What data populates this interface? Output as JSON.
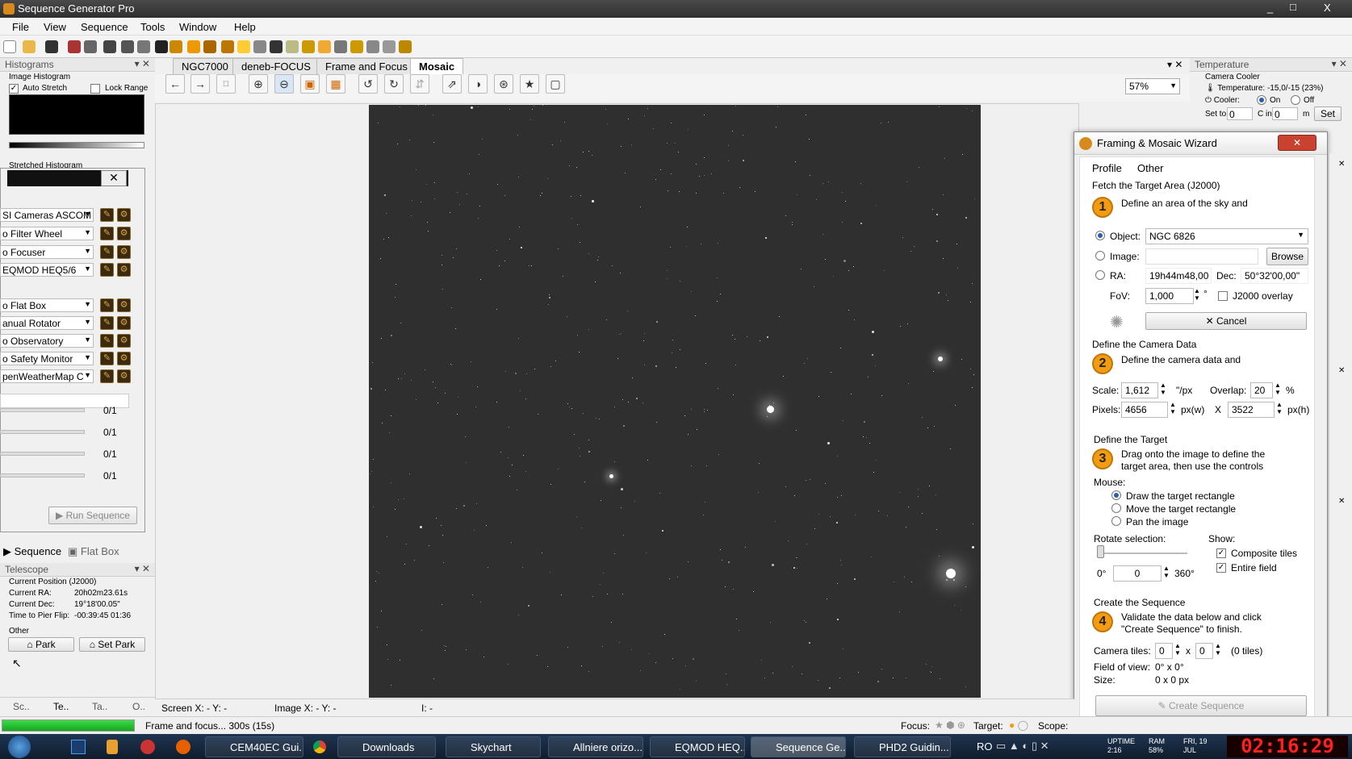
{
  "app": {
    "title": "Sequence Generator Pro",
    "window_controls": [
      "_",
      "□",
      "X"
    ]
  },
  "menu": [
    "File",
    "View",
    "Sequence",
    "Tools",
    "Window",
    "Help"
  ],
  "histograms": {
    "header": "Histograms",
    "image_histogram": "Image Histogram",
    "auto_stretch": "Auto Stretch",
    "lock_range": "Lock Range",
    "stretched": "Stretched Histogram"
  },
  "equipment": {
    "devices": [
      "SI Cameras ASCOM",
      "o Filter Wheel",
      "o Focuser",
      "EQMOD HEQ5/6",
      "o Flat Box",
      "anual Rotator",
      "o Observatory",
      "o Safety Monitor",
      "penWeatherMap C"
    ],
    "progress": [
      "0/1",
      "0/1",
      "0/1",
      "0/1"
    ],
    "run_sequence": "Run Sequence"
  },
  "left_tabs": [
    "Sequence",
    "Flat Box"
  ],
  "telescope": {
    "header": "Telescope",
    "current_position": "Current Position (J2000)",
    "rows": [
      {
        "label": "Current RA:",
        "value": "20h02m23.61s"
      },
      {
        "label": "Current Dec:",
        "value": "19°18'00.05\""
      },
      {
        "label": "Time to Pier Flip:",
        "value": "-00:39:45   01:36"
      }
    ],
    "other": "Other",
    "park": "Park",
    "set_park": "Set Park"
  },
  "bottom_tabs": [
    "Sc..",
    "Te..",
    "Ta..",
    "O.."
  ],
  "doc_tabs": [
    "NGC7000",
    "deneb-FOCUS",
    "Frame and Focus",
    "Mosaic"
  ],
  "zoom": "57%",
  "temperature": {
    "header": "Temperature",
    "camera_cooler": "Camera Cooler",
    "temp_line": "Temperature: -15,0/-15 (23%)",
    "cooler": "Cooler:",
    "on": "On",
    "off": "Off",
    "set_to": "Set to",
    "set_val": "0",
    "c_in": "C in",
    "c_val": "0",
    "m": "m",
    "set_btn": "Set"
  },
  "wizard": {
    "title": "Framing & Mosaic Wizard",
    "tabs": [
      "Profile",
      "Other"
    ],
    "s1": {
      "header": "Fetch the Target Area (J2000)",
      "num": "1",
      "desc": "Define an area of the sky and",
      "object_lbl": "Object:",
      "object_val": "NGC 6826",
      "image_lbl": "Image:",
      "browse": "Browse",
      "ra_lbl": "RA:",
      "ra_val": "19h44m48,00",
      "dec_lbl": "Dec:",
      "dec_val": "50°32'00,00\"",
      "fov_lbl": "FoV:",
      "fov_val": "1,000",
      "fov_unit": "°",
      "j2000": "J2000 overlay",
      "cancel": "Cancel"
    },
    "s2": {
      "header": "Define the Camera Data",
      "num": "2",
      "desc": "Define the camera data and",
      "scale_lbl": "Scale:",
      "scale_val": "1,612",
      "scale_unit": "\"/px",
      "overlap_lbl": "Overlap:",
      "overlap_val": "20",
      "pct": "%",
      "pixels_lbl": "Pixels:",
      "pw": "4656",
      "pw_unit": "px(w)",
      "x": "X",
      "ph": "3522",
      "ph_unit": "px(h)"
    },
    "s3": {
      "header": "Define the Target",
      "num": "3",
      "desc1": "Drag onto the image to define the",
      "desc2": "target area, then use the controls",
      "mouse": "Mouse:",
      "opts": [
        "Draw the target rectangle",
        "Move the target rectangle",
        "Pan the image"
      ],
      "rotate": "Rotate selection:",
      "show": "Show:",
      "composite": "Composite tiles",
      "entire": "Entire field",
      "deg0": "0°",
      "rot_val": "0",
      "deg360": "360°"
    },
    "s4": {
      "header": "Create the Sequence",
      "num": "4",
      "desc1": "Validate the data below and click",
      "desc2": "\"Create Sequence\" to finish.",
      "tiles_lbl": "Camera tiles:",
      "tx": "0",
      "times": "x",
      "ty": "0",
      "tiles_count": "(0 tiles)",
      "fov_lbl": "Field of view:",
      "fov_val": "0° x 0°",
      "size_lbl": "Size:",
      "size_val": "0 x 0 px",
      "create": "Create Sequence"
    }
  },
  "status": {
    "screen": "Screen X: - Y: -",
    "image": "Image X: - Y: -",
    "i": "I: -",
    "frame_focus": "Frame and focus... 300s (15s)",
    "focus": "Focus:",
    "target": "Target:",
    "scope": "Scope:"
  },
  "taskbar": {
    "items": [
      "CEM40EC Gui...",
      "Downloads",
      "Skychart",
      "Allniere orizo...",
      "EQMOD HEQ...",
      "Sequence Ge...",
      "PHD2 Guidin..."
    ],
    "lang": "RO",
    "uptime": "UPTIME\n2:16",
    "ram": "RAM\n58%",
    "date": "FRI, 19\nJUL",
    "clock": "02:16:29"
  }
}
